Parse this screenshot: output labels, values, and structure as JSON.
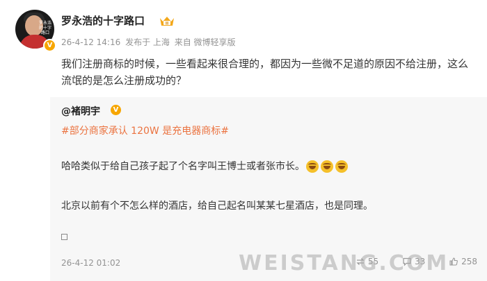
{
  "post": {
    "author": "罗永浩的十字路口",
    "avatar_text": "罗永浩 的十字路口",
    "verified_badge": "V",
    "crown_level": "II",
    "meta": {
      "time": "26-4-12 14:16",
      "location": "发布于 上海",
      "source": "来自 微博轻享版"
    },
    "text": "我们注册商标的时候，一些看起来很合理的，都因为一些微不足道的原因不给注册，这么流氓的是怎么注册成功的？"
  },
  "quoted": {
    "author": "@褚明宇",
    "verified_badge": "V",
    "topic": "#部分商家承认 120W 是充电器商标#",
    "paragraph1": "哈哈类似于给自己孩子起了个名字叫王博士或者张市长。",
    "emojis": [
      "laugh-emoji",
      "laugh-emoji",
      "laugh-emoji"
    ],
    "paragraph2": "北京以前有个不怎么样的酒店，给自己起名叫某某七星酒店，也是同理。",
    "time": "26-4-12 01:02",
    "repost_count": "55",
    "comment_count": "33",
    "like_count": "258"
  },
  "watermark": "WEISTANG.COM",
  "colors": {
    "topic": "#eb7340",
    "badge": "#f7a600",
    "quote_bg": "#f7f7f7",
    "meta": "#939393"
  }
}
